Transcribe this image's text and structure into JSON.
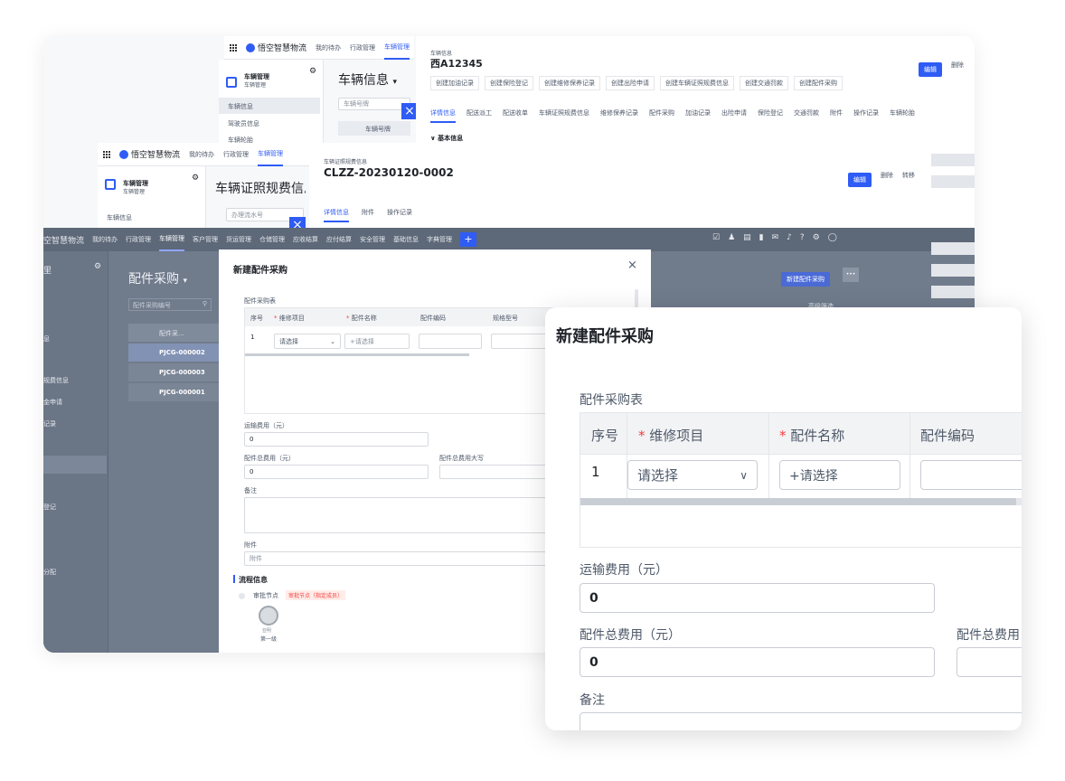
{
  "brand": {
    "name": "悟空智慧物流",
    "name_cut": "空智慧物流"
  },
  "nav": {
    "todo": "我的待办",
    "admin": "行政管理",
    "vehicle": "车辆管理",
    "customer": "客户管理",
    "freight": "货运管理",
    "warehouse": "仓储管理",
    "receivable": "应收结算",
    "payable": "应付结算",
    "safety": "安全管理",
    "basic": "基础信息",
    "dict": "字典管理",
    "plus": "+"
  },
  "sidebar": {
    "title": "车辆管理",
    "subtitle": "车辆管理",
    "items": [
      "车辆信息",
      "驾驶员信息",
      "车辆轮胎"
    ],
    "dark_items": [
      "息",
      "规费信息",
      "金申请",
      "记录",
      "登记",
      "分配"
    ],
    "dark_title": "里"
  },
  "win1": {
    "page_title": "车辆信息",
    "search_placeholder": "车辆号牌",
    "col_header": "车辆号牌",
    "crumb": "车辆信息",
    "plate": "西A12345",
    "actions": [
      "创建加油记录",
      "创建保险登记",
      "创建维修保养记录",
      "创建出险申请",
      "创建车辆证照规费信息",
      "创建交通罚款",
      "创建配件采购"
    ],
    "tabs": [
      "详情信息",
      "配送派工",
      "配送收单",
      "车辆证照规费信息",
      "维修保养记录",
      "配件采购",
      "加油记录",
      "出险申请",
      "保险登记",
      "交通罚款",
      "附件",
      "操作记录",
      "车辆轮胎"
    ],
    "edit": "编辑",
    "delete": "删除",
    "section": "基本信息"
  },
  "win2": {
    "page_title": "车辆证照规费信息",
    "search_placeholder": "办理流水号",
    "crumb": "车辆证照规费信息",
    "code": "CLZZ-20230120-0002",
    "tabs": [
      "详情信息",
      "附件",
      "操作记录"
    ],
    "edit": "编辑",
    "delete": "删除",
    "transfer": "转移"
  },
  "win3": {
    "page_title": "配件采购",
    "search_placeholder": "配件采购编号",
    "col_header": "配件采...",
    "rows": [
      "PJCG-000002",
      "PJCG-000003",
      "PJCG-000001"
    ],
    "new_btn": "新建配件采购",
    "more": "•••",
    "filter": "高级筛选"
  },
  "modal": {
    "title": "新建配件采购",
    "close": "×",
    "table_label": "配件采购表",
    "cols": [
      "序号",
      "维修项目",
      "配件名称",
      "配件编码",
      "规格型号"
    ],
    "row_index": "1",
    "select_placeholder": "请选择",
    "part_placeholder": "+请选择",
    "freight_label": "运输费用（元）",
    "freight_value": "0",
    "total_label": "配件总费用（元）",
    "total_value": "0",
    "total_upper_label": "配件总费用大写",
    "remark_label": "备注",
    "attach_label": "附件",
    "attach_placeholder": "附件",
    "flow_title": "流程信息",
    "node_label": "审批节点",
    "node_tag": "审批节点（指定成员）",
    "approver_name": "亚明",
    "approver_level": "第一级"
  },
  "zoom": {
    "title": "新建配件采购",
    "table_label": "配件采购表",
    "cols": [
      "序号",
      "维修项目",
      "配件名称",
      "配件编码"
    ],
    "row_index": "1",
    "select_placeholder": "请选择",
    "part_placeholder": "+请选择",
    "freight_label": "运输费用（元）",
    "freight_value": "0",
    "total_label": "配件总费用（元）",
    "total_value": "0",
    "total_upper_label": "配件总费用",
    "remark_label": "备注"
  },
  "colors": {
    "primary": "#2f5cf5",
    "required": "#f53f3f",
    "overlay": "#707b8c"
  }
}
